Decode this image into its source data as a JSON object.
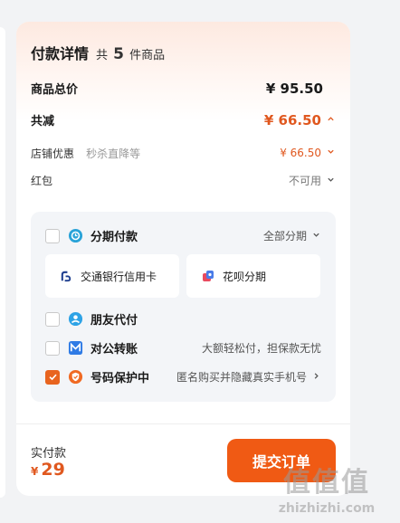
{
  "header": {
    "title": "付款详情",
    "count_prefix": "共",
    "count": "5",
    "count_suffix": "件商品"
  },
  "summary": {
    "goods_total_label": "商品总价",
    "goods_total_value": "¥ 95.50",
    "discount_label": "共减",
    "discount_value": "¥ 66.50",
    "shop_discount_label": "店铺优惠",
    "shop_discount_hint": "秒杀直降等",
    "shop_discount_value": "¥ 66.50",
    "red_packet_label": "红包",
    "red_packet_value": "不可用"
  },
  "payment": {
    "installment": {
      "label": "分期付款",
      "right": "全部分期",
      "checked": false
    },
    "installment_options": [
      {
        "label": "交通银行信用卡",
        "icon": "bocom-logo-icon"
      },
      {
        "label": "花呗分期",
        "icon": "huabei-icon"
      }
    ],
    "friend_pay": {
      "label": "朋友代付",
      "checked": false
    },
    "corporate": {
      "label": "对公转账",
      "right": "大额轻松付，担保款无忧",
      "checked": false
    },
    "number_protect": {
      "label": "号码保护中",
      "right": "匿名购买并隐藏真实手机号",
      "checked": true
    }
  },
  "footer": {
    "total_label": "实付款",
    "currency": "¥",
    "total_amount": "29",
    "submit_label": "提交订单"
  },
  "watermark": {
    "logo": "值值值",
    "text": "zhizhizhi.com"
  },
  "colors": {
    "accent": "#f05a14",
    "price_orange": "#e0581f",
    "panel_bg": "#f3f5f8"
  }
}
